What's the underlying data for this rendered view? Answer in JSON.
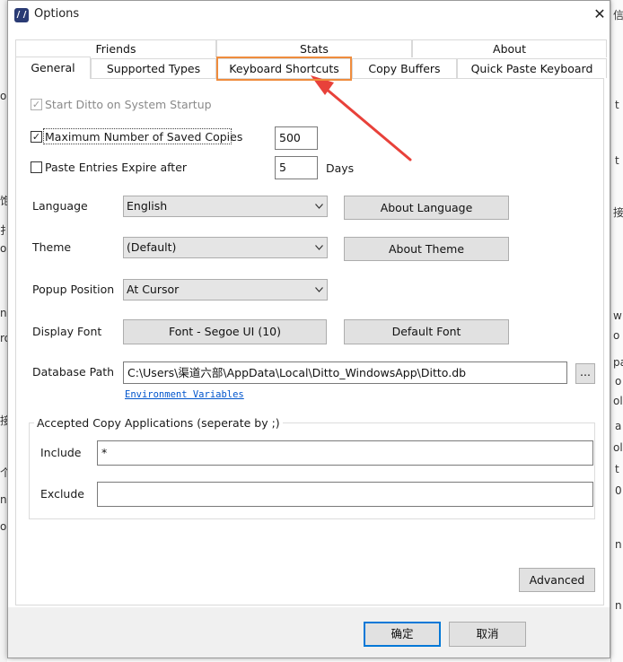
{
  "window": {
    "title": "Options",
    "close_symbol": "✕",
    "icon_glyph": "/ /"
  },
  "tabs": {
    "upper": [
      "Friends",
      "Stats",
      "About"
    ],
    "lower": [
      "General",
      "Supported Types",
      "Keyboard Shortcuts",
      "Copy Buffers",
      "Quick Paste Keyboard"
    ],
    "active": "General",
    "highlighted": "Keyboard Shortcuts"
  },
  "general": {
    "start_on_startup": {
      "label": "Start Ditto on System Startup",
      "checked": true,
      "enabled": false,
      "check_mark": "✓"
    },
    "max_copies": {
      "label": "Maximum Number of Saved Copies",
      "checked": true,
      "value": "500",
      "check_mark": "✓"
    },
    "expire": {
      "label": "Paste Entries Expire after",
      "checked": false,
      "value": "5",
      "unit": "Days"
    },
    "language": {
      "label": "Language",
      "value": "English",
      "button": "About Language"
    },
    "theme": {
      "label": "Theme",
      "value": "(Default)",
      "button": "About Theme"
    },
    "popup_position": {
      "label": "Popup Position",
      "value": "At Cursor"
    },
    "display_font": {
      "label": "Display Font",
      "font_button": "Font - Segoe UI (10)",
      "default_button": "Default Font"
    },
    "database_path": {
      "label": "Database Path",
      "value": "C:\\Users\\渠道六部\\AppData\\Local\\Ditto_WindowsApp\\Ditto.db",
      "browse": "...",
      "env_link": "Environment Variables"
    },
    "accepted_apps": {
      "legend": "Accepted Copy Applications (seperate by ;)",
      "include_label": "Include",
      "include_value": "*",
      "exclude_label": "Exclude",
      "exclude_value": ""
    },
    "advanced_button": "Advanced"
  },
  "footer": {
    "ok": "确定",
    "cancel": "取消"
  },
  "background": {
    "left_glyphs": [
      "o",
      "饱",
      "扌",
      "o",
      "n",
      "ro",
      "接",
      "个",
      "n",
      "o"
    ],
    "right_glyphs": [
      "信",
      "t",
      "t",
      "接",
      "w",
      "o",
      "pa",
      "o",
      "ol",
      "a",
      "ol",
      "t",
      "0",
      "n",
      "n"
    ]
  },
  "colors": {
    "highlight": "#ef8c3d",
    "arrow": "#e8413a",
    "link": "#0055cc",
    "default_button_border": "#0078d7"
  }
}
